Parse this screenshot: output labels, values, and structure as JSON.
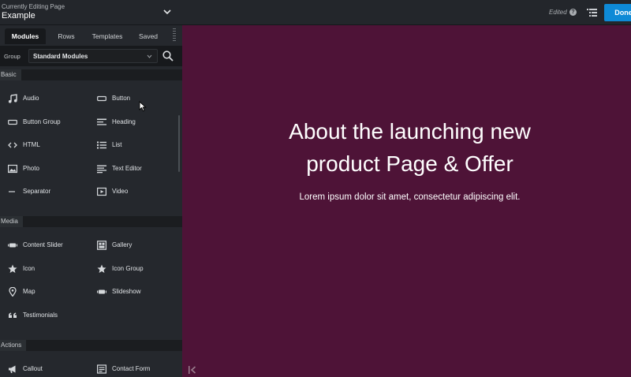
{
  "topbar": {
    "editing_caption": "Currently Editing Page",
    "page_name": "Example",
    "status": "Edited",
    "done_label": "Done"
  },
  "sidebar": {
    "tabs": [
      {
        "label": "Modules",
        "active": true
      },
      {
        "label": "Rows",
        "active": false
      },
      {
        "label": "Templates",
        "active": false
      },
      {
        "label": "Saved",
        "active": false
      }
    ],
    "group_label": "Group",
    "group_value": "Standard Modules",
    "sections": [
      {
        "name": "Basic",
        "items": [
          {
            "label": "Audio",
            "icon": "music-note-icon"
          },
          {
            "label": "Button",
            "icon": "button-icon"
          },
          {
            "label": "Button Group",
            "icon": "button-group-icon"
          },
          {
            "label": "Heading",
            "icon": "heading-icon"
          },
          {
            "label": "HTML",
            "icon": "code-icon"
          },
          {
            "label": "List",
            "icon": "list-icon"
          },
          {
            "label": "Photo",
            "icon": "photo-icon"
          },
          {
            "label": "Text Editor",
            "icon": "text-editor-icon"
          },
          {
            "label": "Separator",
            "icon": "separator-icon"
          },
          {
            "label": "Video",
            "icon": "video-icon"
          }
        ]
      },
      {
        "name": "Media",
        "items": [
          {
            "label": "Content Slider",
            "icon": "slider-icon"
          },
          {
            "label": "Gallery",
            "icon": "gallery-icon"
          },
          {
            "label": "Icon",
            "icon": "star-icon"
          },
          {
            "label": "Icon Group",
            "icon": "star-icon"
          },
          {
            "label": "Map",
            "icon": "map-pin-icon"
          },
          {
            "label": "Slideshow",
            "icon": "slideshow-icon"
          },
          {
            "label": "Testimonials",
            "icon": "quote-icon"
          }
        ]
      },
      {
        "name": "Actions",
        "items": [
          {
            "label": "Callout",
            "icon": "megaphone-icon"
          },
          {
            "label": "Contact Form",
            "icon": "form-icon"
          }
        ]
      }
    ]
  },
  "canvas": {
    "headline_line1": "About the launching new",
    "headline_line2": "product Page & Offer",
    "subtext": "Lorem ipsum dolor sit amet, consectetur adipiscing elit.",
    "background": "#4e1337"
  },
  "colors": {
    "accent": "#0e8ad6",
    "sidebar": "#25282d"
  }
}
